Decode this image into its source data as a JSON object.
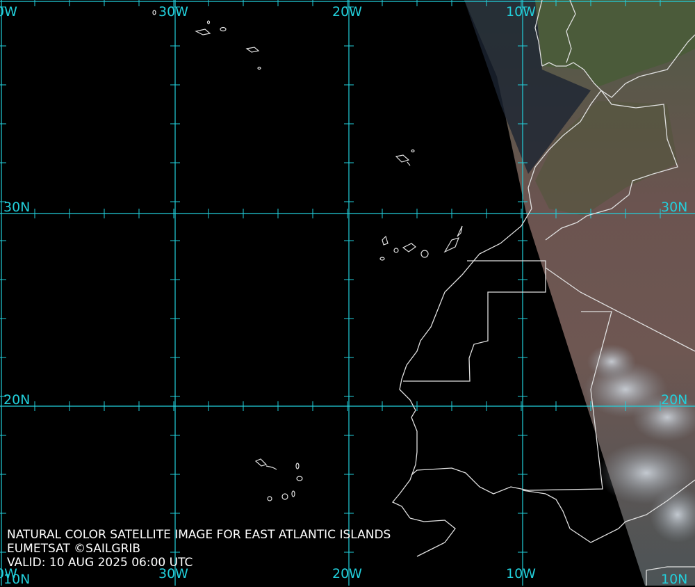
{
  "grid": {
    "top_lon_labels": [
      "0W",
      "30W",
      "20W",
      "10W"
    ],
    "bottom_lon_labels": [
      "0W",
      "30W",
      "20W",
      "10W"
    ],
    "lat_labels_left": [
      "30N",
      "20N",
      "10N"
    ],
    "lat_labels_right": [
      "30N",
      "20N",
      "10N"
    ],
    "line_color": "#22d0dc"
  },
  "caption": {
    "line1": "NATURAL COLOR SATELLITE IMAGE FOR EAST ATLANTIC ISLANDS",
    "line2": "EUMETSAT ©SAILGRIB",
    "line3": "VALID:  10 AUG 2025 06:00 UTC"
  },
  "colors": {
    "ocean": "#000000",
    "land": "#5a4a45",
    "vegetation": "#4a5a3a",
    "coastline": "#e0e0e0"
  }
}
